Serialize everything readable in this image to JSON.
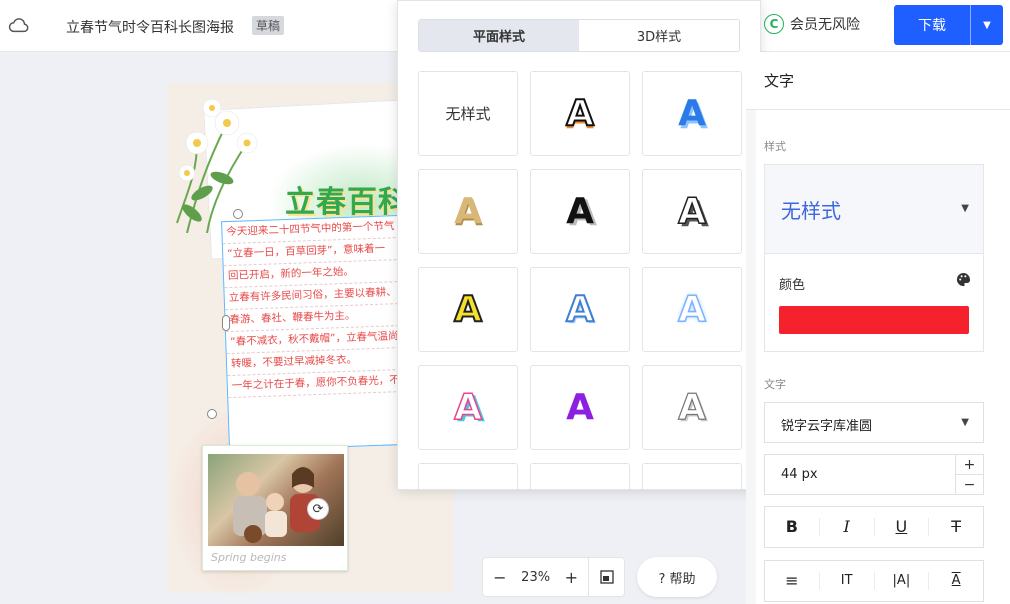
{
  "header": {
    "title": "立春节气时令百科长图海报",
    "badge": "草稿",
    "vip_text": "会员无风险",
    "vip_icon": "C",
    "download_label": "下载"
  },
  "poster": {
    "headline": "立春百科",
    "paragraphs": [
      "今天迎来二十四节气中的第一个节气",
      "“立春一日，百草回芽”，意味着一",
      "回已开启，新的一年之始。",
      "立春有许多民间习俗，主要以春耕、祝",
      "春游、春社、鞭春牛为主。",
      "“春不减衣，秋不戴帽”，立春气温尚未",
      "转暖，不要过早减掉冬衣。",
      "一年之计在于春，愿你不负春光，不负梦"
    ],
    "photo_caption": "Spring begins"
  },
  "zoom": {
    "minus": "−",
    "value": "23%",
    "plus": "+"
  },
  "help_label": "? 帮助",
  "style_popover": {
    "tabs": [
      {
        "label": "平面样式",
        "active": true
      },
      {
        "label": "3D样式",
        "active": false
      }
    ],
    "items": [
      {
        "label": "无样式",
        "kind": "plain"
      },
      {
        "label": "A",
        "kind": "black-outline-orange"
      },
      {
        "label": "A",
        "kind": "blue-3d"
      },
      {
        "label": "A",
        "kind": "gold"
      },
      {
        "label": "A",
        "kind": "black-shadow"
      },
      {
        "label": "A",
        "kind": "outline-3d"
      },
      {
        "label": "A",
        "kind": "yellow-outline"
      },
      {
        "label": "A",
        "kind": "blue-outline"
      },
      {
        "label": "A",
        "kind": "light-blue-glow"
      },
      {
        "label": "A",
        "kind": "pink-cyan"
      },
      {
        "label": "A",
        "kind": "purple"
      },
      {
        "label": "A",
        "kind": "gray-outline"
      }
    ]
  },
  "panel": {
    "title": "文字",
    "style_section": "样式",
    "style_value": "无样式",
    "color_label": "颜色",
    "color_value": "#f5222d",
    "text_section": "文字",
    "font_value": "锐字云字库准圆",
    "size_value": "44 px",
    "format_buttons": [
      "B",
      "I",
      "U",
      "T"
    ],
    "align_buttons": [
      "≡",
      "IT",
      "|A|",
      "A"
    ]
  }
}
